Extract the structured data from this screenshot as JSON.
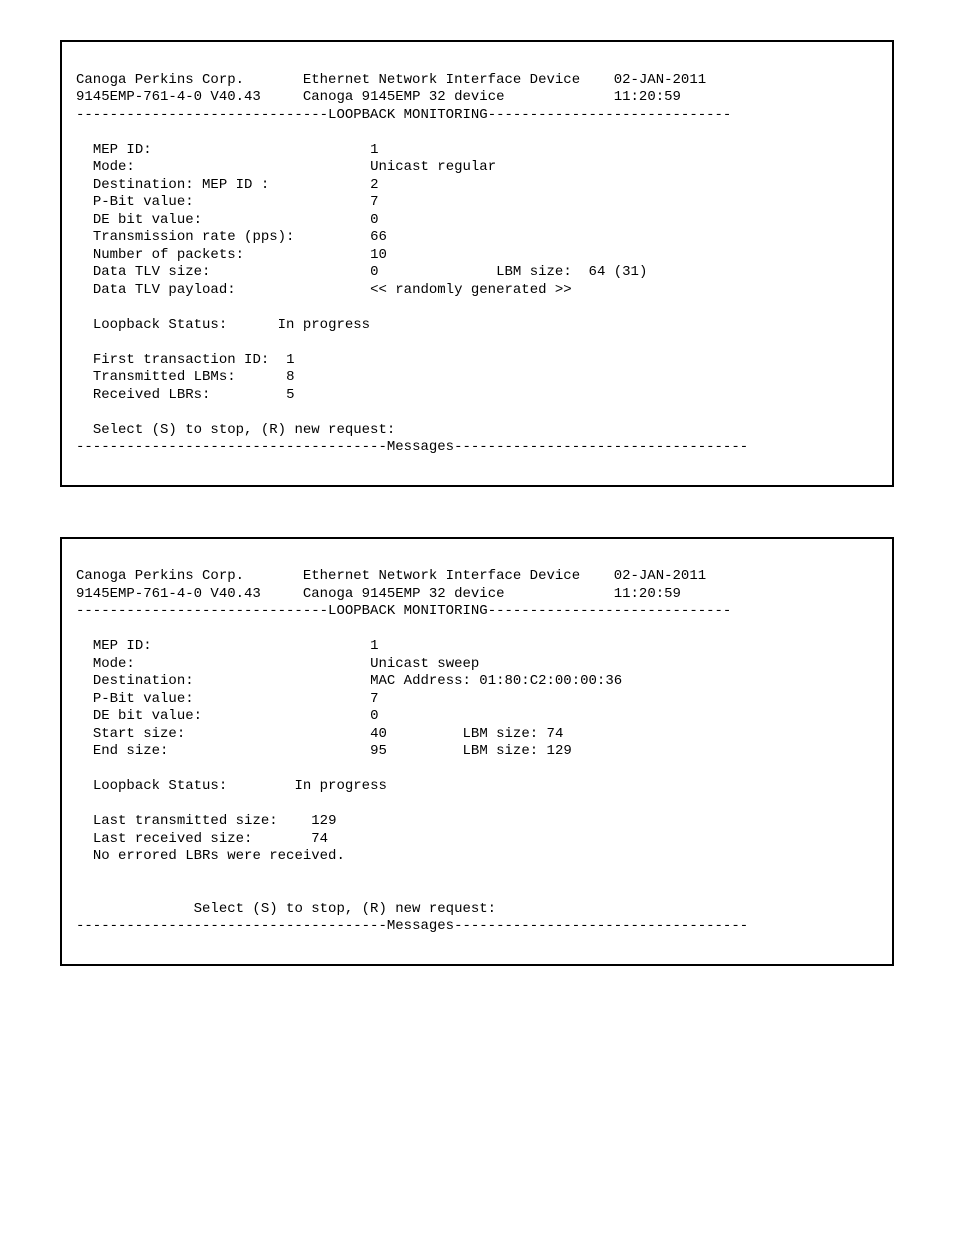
{
  "screen1": {
    "header": {
      "company": "Canoga Perkins Corp.",
      "title": "Ethernet Network Interface Device",
      "date": "02-JAN-2011",
      "model": "9145EMP-761-4-0 V40.43",
      "device": "Canoga 9145EMP 32 device",
      "time": "11:20:59",
      "section_dashes_left": "------------------------------",
      "section_title": "LOOPBACK MONITORING",
      "section_dashes_right": "-----------------------------"
    },
    "fields": {
      "mep_id_label": "MEP ID:",
      "mep_id_value": "1",
      "mode_label": "Mode:",
      "mode_value": "Unicast regular",
      "destination_label": "Destination: MEP ID :",
      "destination_value": "2",
      "pbit_label": "P-Bit value:",
      "pbit_value": "7",
      "debit_label": "DE bit value:",
      "debit_value": "0",
      "txrate_label": "Transmission rate (pps):",
      "txrate_value": "66",
      "numpkts_label": "Number of packets:",
      "numpkts_value": "10",
      "tlvsize_label": "Data TLV size:",
      "tlvsize_value": "0",
      "lbmsize_label": "LBM size:",
      "lbmsize_value": "64 (31)",
      "tlvpayload_label": "Data TLV payload:",
      "tlvpayload_value": "<< randomly generated >>",
      "status_label": "Loopback Status:",
      "status_value": "In progress",
      "firsttx_label": "First transaction ID:",
      "firsttx_value": "1",
      "txlbm_label": "Transmitted LBMs:",
      "txlbm_value": "8",
      "rxlbr_label": "Received LBRs:",
      "rxlbr_value": "5",
      "prompt": "Select (S) to stop, (R) new request:",
      "msg_dashes_left": "-------------------------------------",
      "msg_title": "Messages",
      "msg_dashes_right": "-----------------------------------"
    }
  },
  "screen2": {
    "header": {
      "company": "Canoga Perkins Corp.",
      "title": "Ethernet Network Interface Device",
      "date": "02-JAN-2011",
      "model": "9145EMP-761-4-0 V40.43",
      "device": "Canoga 9145EMP 32 device",
      "time": "11:20:59",
      "section_dashes_left": "------------------------------",
      "section_title": "LOOPBACK MONITORING",
      "section_dashes_right": "-----------------------------"
    },
    "fields": {
      "mep_id_label": "MEP ID:",
      "mep_id_value": "1",
      "mode_label": "Mode:",
      "mode_value": "Unicast sweep",
      "destination_label": "Destination:",
      "destination_value": "MAC Address: 01:80:C2:00:00:36",
      "pbit_label": "P-Bit value:",
      "pbit_value": "7",
      "debit_label": "DE bit value:",
      "debit_value": "0",
      "startsize_label": "Start size:",
      "startsize_value": "40",
      "startsize_lbm_label": "LBM size:",
      "startsize_lbm_value": "74",
      "endsize_label": "End size:",
      "endsize_value": "95",
      "endsize_lbm_label": "LBM size:",
      "endsize_lbm_value": "129",
      "status_label": "Loopback Status:",
      "status_value": "In progress",
      "lasttx_label": "Last transmitted size:",
      "lasttx_value": "129",
      "lastrx_label": "Last received size:",
      "lastrx_value": "74",
      "noerr": "No errored LBRs were received.",
      "prompt": "Select (S) to stop, (R) new request:",
      "msg_dashes_left": "-------------------------------------",
      "msg_title": "Messages",
      "msg_dashes_right": "-----------------------------------"
    }
  }
}
